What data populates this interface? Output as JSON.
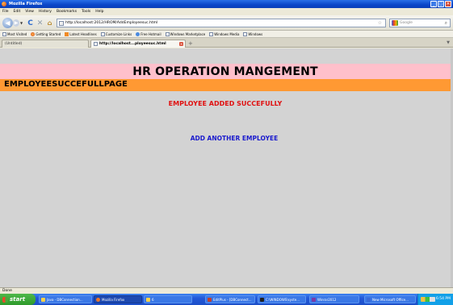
{
  "window": {
    "title": "Mozilla Firefox",
    "min": "_",
    "max": "□",
    "close": "✕"
  },
  "menu": [
    "File",
    "Edit",
    "View",
    "History",
    "Bookmarks",
    "Tools",
    "Help"
  ],
  "nav": {
    "url": "http://localhost:2012/HROM/AddEmployeesuc.html",
    "search_placeholder": "Google"
  },
  "bookmarks": [
    {
      "label": "Most Visited",
      "icon": "page-icon"
    },
    {
      "label": "Getting Started",
      "icon": "firefox-icon"
    },
    {
      "label": "Latest Headlines",
      "icon": "rss-icon"
    },
    {
      "label": "Customize Links",
      "icon": "page-icon"
    },
    {
      "label": "Free Hotmail",
      "icon": "ie-icon"
    },
    {
      "label": "Windows Marketplace",
      "icon": "page-icon"
    },
    {
      "label": "Windows Media",
      "icon": "page-icon"
    },
    {
      "label": "Windows",
      "icon": "page-icon"
    }
  ],
  "tabs": [
    {
      "label": "(Untitled)",
      "active": false
    },
    {
      "label": "http://localhost...ployeesuc.html",
      "active": true
    }
  ],
  "page": {
    "header_title": "HR OPERATION MANGEMENT",
    "subheader": "EMPLOYEESUCCEFULLPAGE",
    "message": "EMPLOYEE ADDED SUCCEFULLY",
    "link": "ADD ANOTHER EMPLOYEE"
  },
  "status": "Done",
  "taskbar": {
    "start": "start",
    "items": [
      {
        "label": "Java - DBConnection..."
      },
      {
        "label": "Mozilla Firefox"
      },
      {
        "label": "6"
      },
      {
        "label": "EditPlus - [DBConnect..."
      },
      {
        "label": "C:\\WINDOWS\\syste..."
      },
      {
        "label": "Winrar2012"
      },
      {
        "label": "New Microsoft Office..."
      }
    ],
    "clock": "6:54 PM"
  },
  "colors": {
    "header_bg": "#ffc0cb",
    "subheader_bg": "#ff9933",
    "message": "#e01010",
    "link": "#1a1acd",
    "content_bg": "#d3d3d3"
  }
}
